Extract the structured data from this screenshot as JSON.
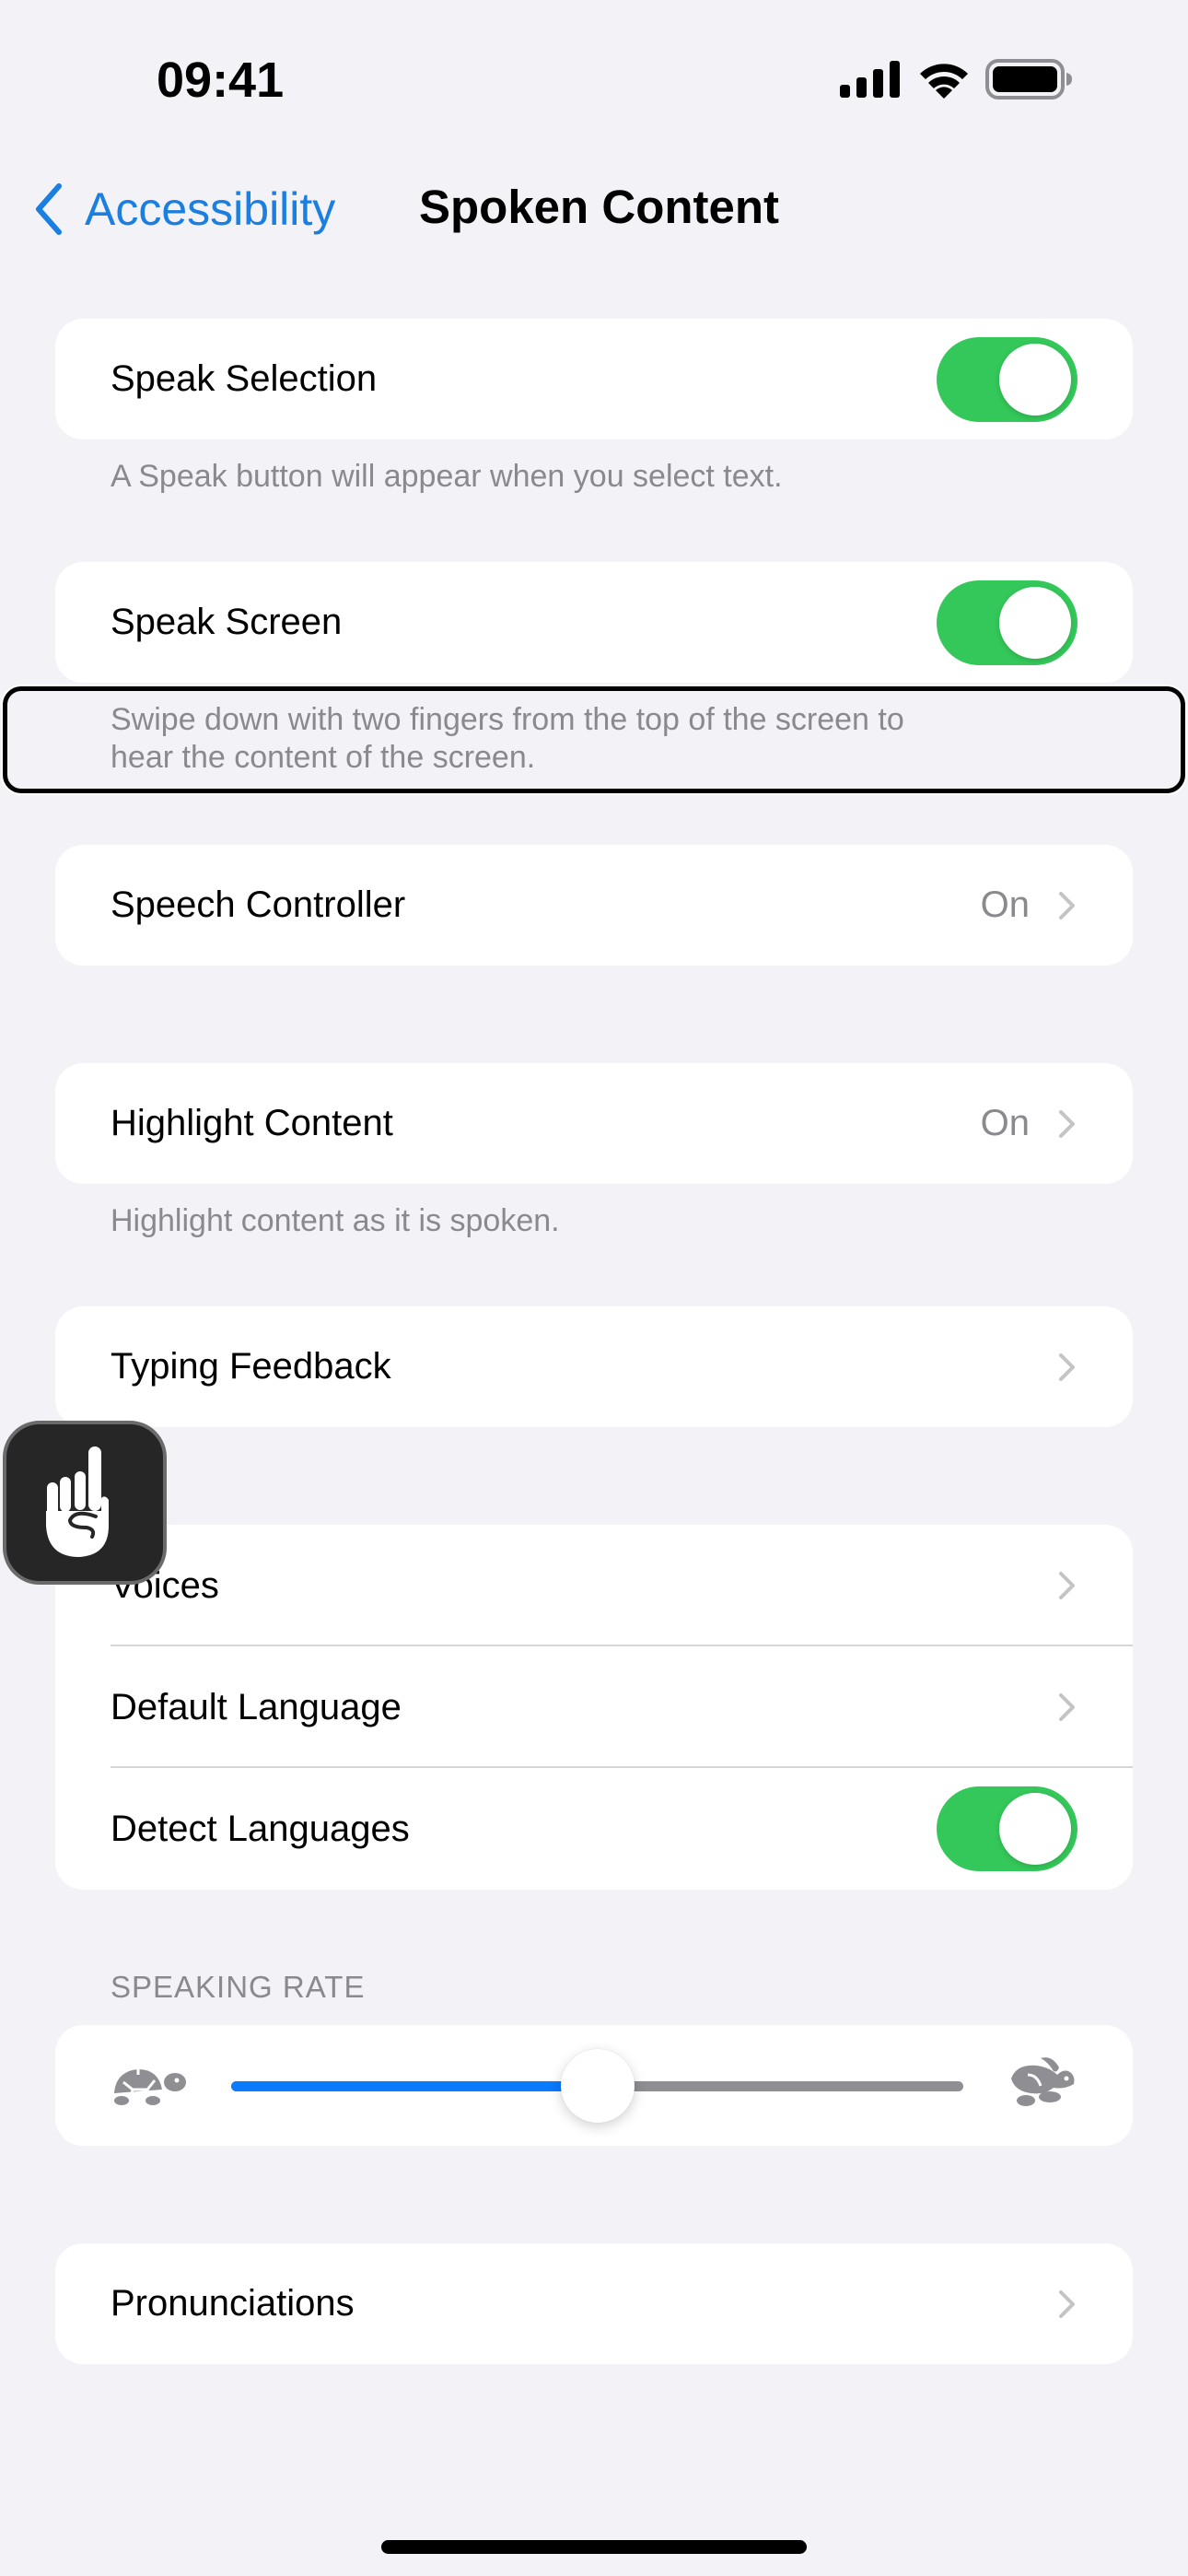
{
  "status_bar": {
    "time": "09:41",
    "icons": [
      "cellular-signal-icon",
      "wifi-icon",
      "battery-icon"
    ]
  },
  "nav": {
    "back_label": "Accessibility",
    "title": "Spoken Content"
  },
  "colors": {
    "accent": "#1a7fe0",
    "toggle_on": "#34c759",
    "slider_fill": "#0a7aff",
    "background": "#f2f2f7"
  },
  "sections": {
    "speak_selection": {
      "label": "Speak Selection",
      "toggle_on": true,
      "footer": "A Speak button will appear when you select text."
    },
    "speak_screen": {
      "label": "Speak Screen",
      "toggle_on": true,
      "footer_line1": "Swipe down with two fingers from the top of the screen to",
      "footer_line2": "hear the content of the screen."
    },
    "speech_controller": {
      "label": "Speech Controller",
      "value": "On"
    },
    "highlight_content": {
      "label": "Highlight Content",
      "value": "On",
      "footer": "Highlight content as it is spoken."
    },
    "typing_feedback": {
      "label": "Typing Feedback"
    },
    "voice_group": {
      "items": [
        {
          "label": "Voices",
          "type": "chevron"
        },
        {
          "label": "Default Language",
          "type": "chevron"
        },
        {
          "label": "Detect Languages",
          "type": "toggle",
          "toggle_on": true
        }
      ]
    },
    "speaking_rate": {
      "header": "SPEAKING RATE",
      "value_fraction": 0.5,
      "min_icon": "turtle-icon",
      "max_icon": "rabbit-icon"
    },
    "pronunciations": {
      "label": "Pronunciations"
    }
  },
  "assistive_touch": {
    "icon": "hand-pointing-up-icon"
  }
}
